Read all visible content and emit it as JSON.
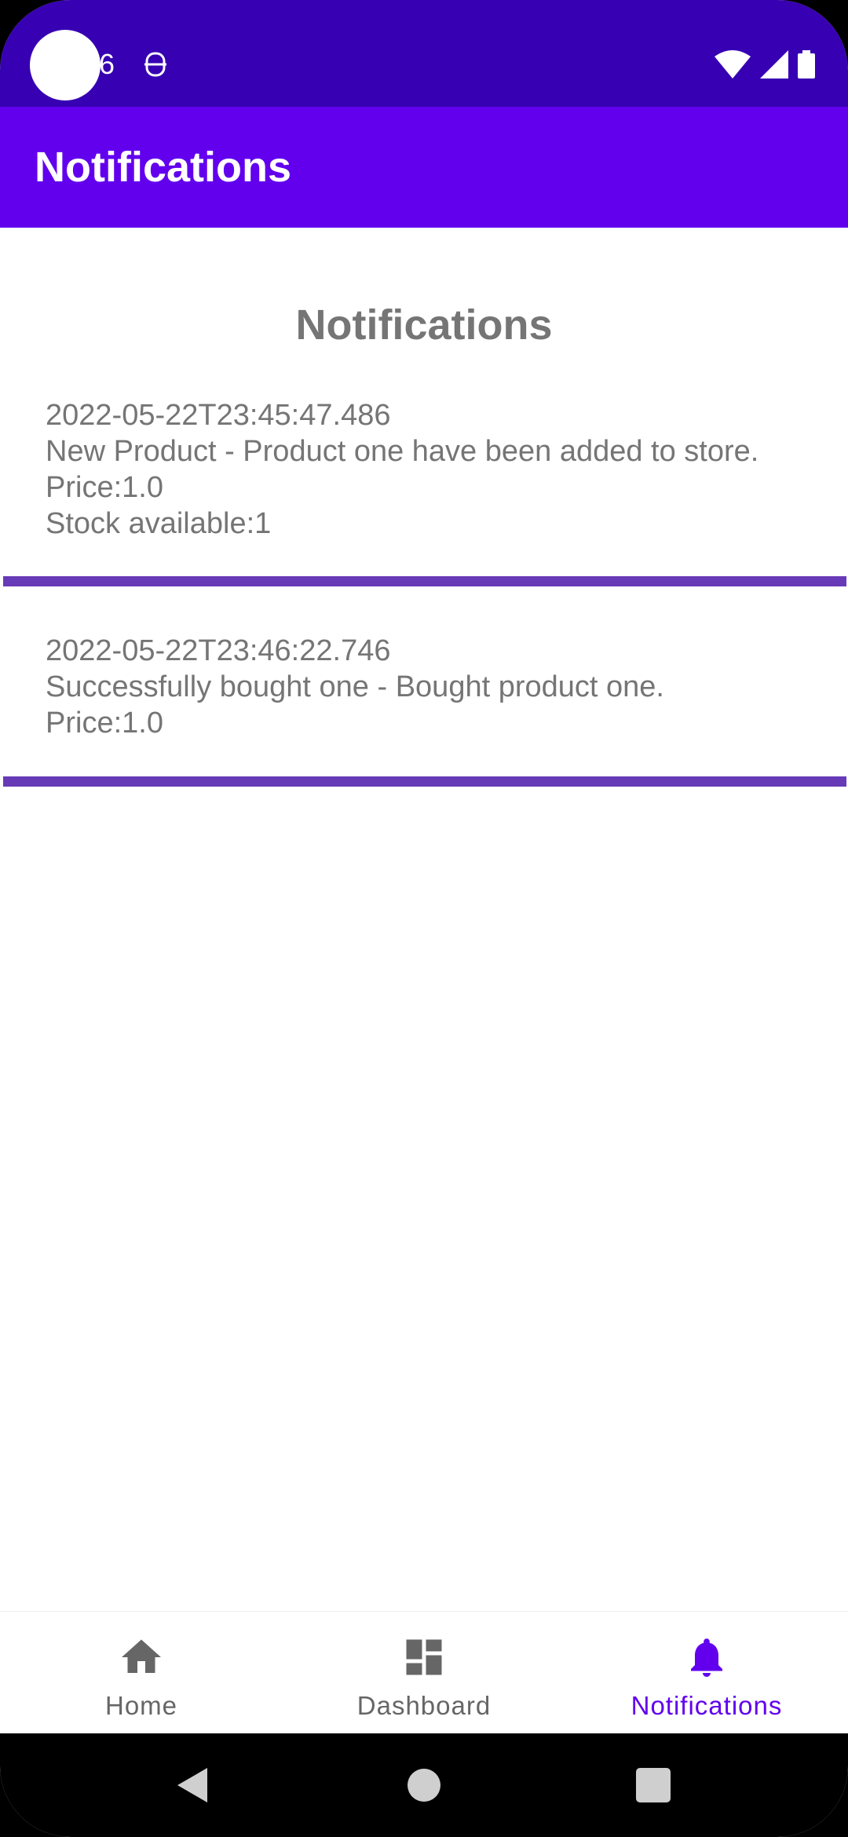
{
  "status_bar": {
    "time": "6",
    "app_icon": "notification-app-icon",
    "icons": [
      "wifi-icon",
      "signal-icon",
      "battery-icon"
    ]
  },
  "app_bar": {
    "title": "Notifications"
  },
  "main": {
    "heading": "Notifications",
    "notifications": [
      {
        "timestamp": "2022-05-22T23:45:47.486",
        "message": "New Product - Product one have been added to store.",
        "price": "Price:1.0",
        "stock": "Stock available:1"
      },
      {
        "timestamp": "2022-05-22T23:46:22.746",
        "message": "Successfully bought one - Bought product one.",
        "price": "Price:1.0"
      }
    ]
  },
  "bottom_nav": {
    "items": [
      {
        "label": "Home",
        "icon": "home-icon",
        "active": false
      },
      {
        "label": "Dashboard",
        "icon": "dashboard-icon",
        "active": false
      },
      {
        "label": "Notifications",
        "icon": "bell-icon",
        "active": true
      }
    ]
  },
  "colors": {
    "status_bar": "#3700b3",
    "app_bar": "#6200ee",
    "divider": "#673ab7",
    "text_secondary": "#757575",
    "nav_active": "#6200ee"
  }
}
